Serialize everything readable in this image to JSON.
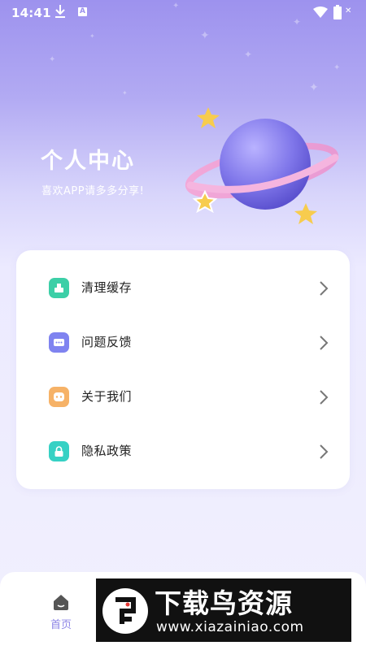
{
  "status_bar": {
    "time": "14:41",
    "a_badge": "A",
    "download_icon": "download-arrow-icon",
    "wifi_icon": "wifi-icon",
    "battery_icon": "battery-icon",
    "battery_text": "✕"
  },
  "header": {
    "title": "个人中心",
    "subtitle": "喜欢APP请多多分享!"
  },
  "menu": {
    "items": [
      {
        "label": "清理缓存",
        "icon": "broom-clean-icon",
        "color": "#3ccfa7"
      },
      {
        "label": "问题反馈",
        "icon": "feedback-chat-icon",
        "color": "#7f83f0"
      },
      {
        "label": "关于我们",
        "icon": "smile-about-icon",
        "color": "#f6b267"
      },
      {
        "label": "隐私政策",
        "icon": "lock-privacy-icon",
        "color": "#36d1c4"
      }
    ]
  },
  "bottom_nav": {
    "home_label": "首页",
    "home_icon": "home-icon",
    "active_color": "#8c84e6"
  },
  "watermark": {
    "title": "下载鸟资源",
    "url": "www.xiazainiao.com"
  },
  "colors": {
    "header_gradient_top": "#9d92ee",
    "page_background": "#f1f0fd"
  }
}
